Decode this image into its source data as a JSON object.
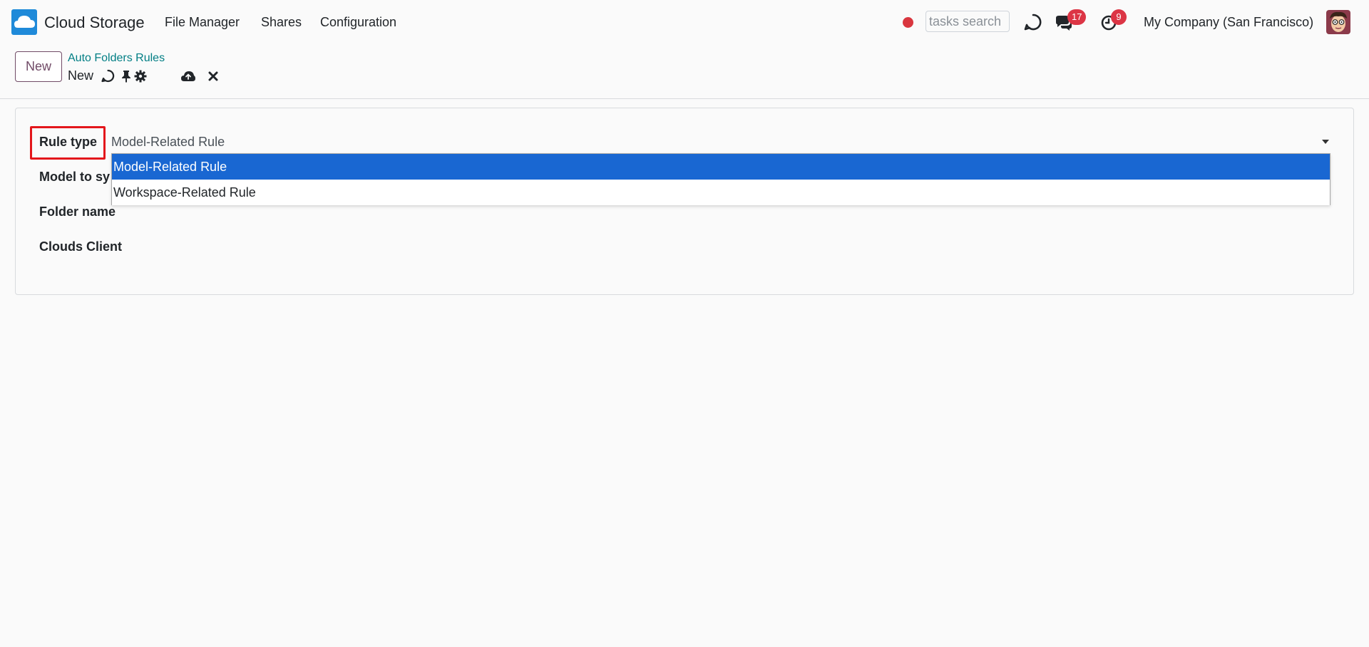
{
  "navbar": {
    "app_name": "Cloud Storage",
    "menu": [
      "File Manager",
      "Shares",
      "Configuration"
    ],
    "search_placeholder": "tasks search",
    "messages_badge": "17",
    "activities_badge": "9",
    "company": "My Company (San Francisco)",
    "icons": [
      "cloud-logo-icon",
      "recording-dot-icon",
      "refresh-icon",
      "chat-icon",
      "clock-icon",
      "avatar"
    ],
    "colors": {
      "brand": "#714b67",
      "link": "#017e84",
      "badge": "#dc3545",
      "recording": "#d9363e"
    }
  },
  "control_panel": {
    "new_button": "New",
    "breadcrumb": "Auto Folders Rules",
    "record_name": "New",
    "icons": [
      "sync-icon",
      "pin-icon",
      "gear-icon",
      "cloud-upload-icon",
      "close-icon"
    ]
  },
  "form": {
    "labels": {
      "rule_type": "Rule type",
      "model_to_sync": "Model to sy",
      "folder_name": "Folder name",
      "clouds_client": "Clouds Client"
    },
    "rule_type_value": "Model-Related Rule",
    "rule_type_options": [
      "Model-Related Rule",
      "Workspace-Related Rule"
    ],
    "selected_option_color": "#1967d2",
    "highlight_color": "#e3161b"
  }
}
